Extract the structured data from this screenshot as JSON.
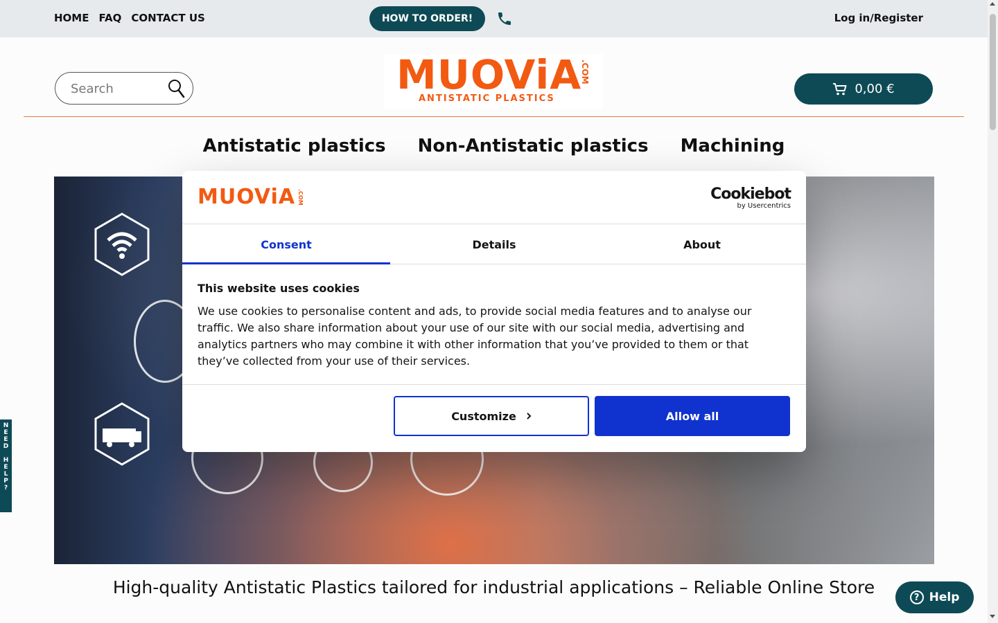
{
  "topbar": {
    "links": [
      "HOME",
      "FAQ",
      "CONTACT US"
    ],
    "how_to_order": "HOW TO ORDER!",
    "login": "Log in/Register"
  },
  "header": {
    "search_placeholder": "Search",
    "logo_text": "MUOViA",
    "logo_com": ".COM",
    "logo_sub": "ANTISTATIC PLASTICS",
    "cart_total": "0,00 €"
  },
  "mainnav": [
    "Antistatic plastics",
    "Non-Antistatic plastics",
    "Machining"
  ],
  "tagline": "High-quality Antistatic Plastics tailored for industrial applications – Reliable Online Store",
  "side_tab": "NEED HELP?",
  "help_button": "Help",
  "cookie_dialog": {
    "logo_text": "MUOViA",
    "logo_com": ".COM",
    "provider": "Cookiebot",
    "provider_sub": "by Usercentrics",
    "tabs": [
      "Consent",
      "Details",
      "About"
    ],
    "active_tab": "Consent",
    "title": "This website uses cookies",
    "body": "We use cookies to personalise content and ads, to provide social media features and to analyse our traffic. We also share information about your use of our site with our social media, advertising and analytics partners who may combine it with other information that you’ve provided to them or that they’ve collected from your use of their services.",
    "customize_label": "Customize",
    "allow_all_label": "Allow all"
  },
  "colors": {
    "brand_dark_teal": "#0e4a55",
    "brand_orange": "#f25a12",
    "cookie_blue": "#1032cf"
  }
}
